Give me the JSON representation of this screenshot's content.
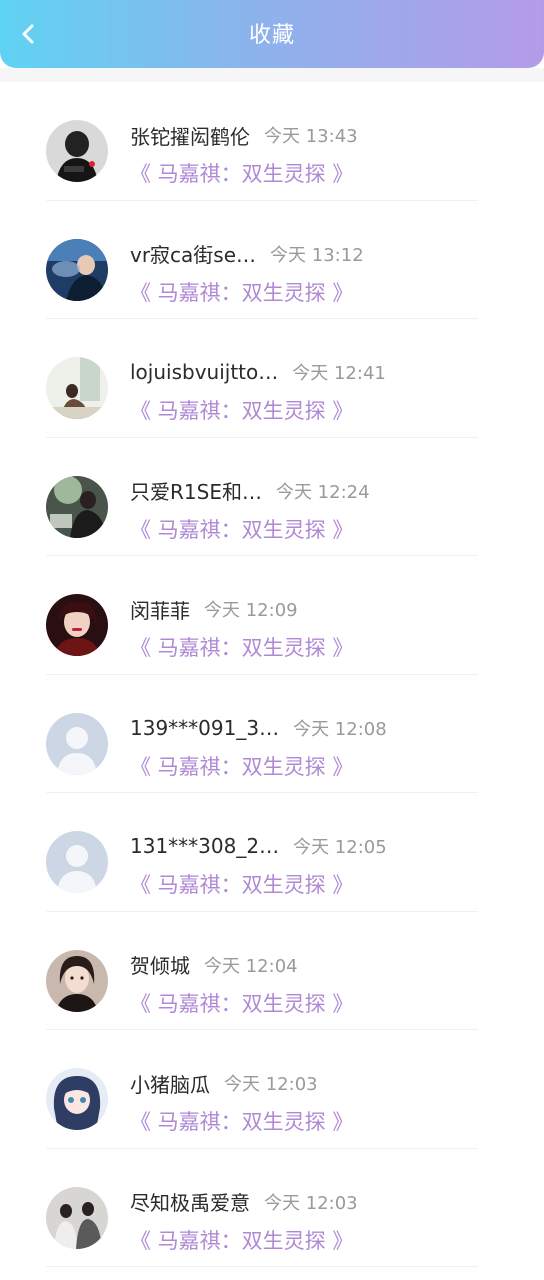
{
  "header": {
    "title": "收藏",
    "back_icon": "chevron-left-icon",
    "gradient": [
      "#5fd3f3",
      "#b49bea"
    ]
  },
  "items": [
    {
      "name": "张铊擢闳鹤伦",
      "time": "今天 13:43",
      "work": "《 马嘉祺：双生灵探 》",
      "avatar": "photo-dark"
    },
    {
      "name": "vr寂ca街se…",
      "time": "今天 13:12",
      "work": "《 马嘉祺：双生灵探 》",
      "avatar": "photo-blue"
    },
    {
      "name": "lojuisbvuijtto…",
      "time": "今天 12:41",
      "work": "《 马嘉祺：双生灵探 》",
      "avatar": "photo-light"
    },
    {
      "name": "只爱R1SE和…",
      "time": "今天 12:24",
      "work": "《 马嘉祺：双生灵探 》",
      "avatar": "photo-green"
    },
    {
      "name": "闵菲菲",
      "time": "今天 12:09",
      "work": "《 马嘉祺：双生灵探 》",
      "avatar": "photo-red"
    },
    {
      "name": "139***091_3…",
      "time": "今天 12:08",
      "work": "《 马嘉祺：双生灵探 》",
      "avatar": "default"
    },
    {
      "name": "131***308_2…",
      "time": "今天 12:05",
      "work": "《 马嘉祺：双生灵探 》",
      "avatar": "default"
    },
    {
      "name": "贺倾城",
      "time": "今天 12:04",
      "work": "《 马嘉祺：双生灵探 》",
      "avatar": "photo-portrait"
    },
    {
      "name": "小猪脑瓜",
      "time": "今天 12:03",
      "work": "《 马嘉祺：双生灵探 》",
      "avatar": "photo-anime"
    },
    {
      "name": "尽知极禹爱意",
      "time": "今天 12:03",
      "work": "《 马嘉祺：双生灵探 》",
      "avatar": "photo-group"
    }
  ],
  "colors": {
    "accent": "#b089d6",
    "name": "#2b2b2b",
    "time": "#9a9a9a"
  }
}
